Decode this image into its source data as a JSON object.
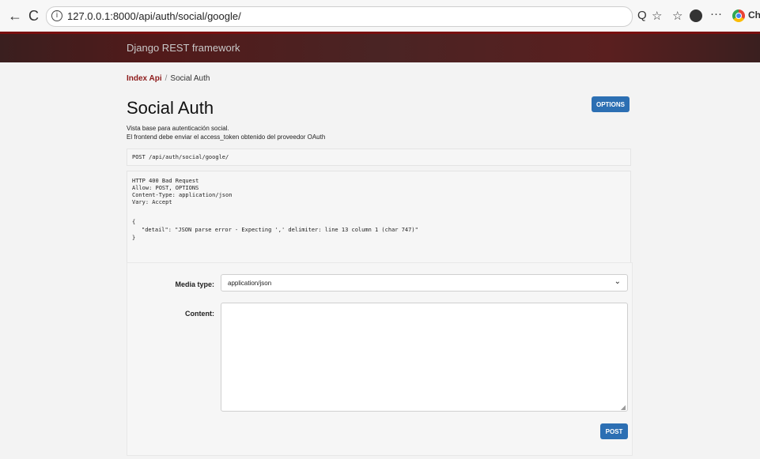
{
  "browser": {
    "back_icon": "←",
    "reload_icon": "C",
    "info_icon": "i",
    "url": "127.0.0.1:8000/api/auth/social/google/",
    "zoom_icon": "Q",
    "favorite_icon": "☆",
    "collections_icon": "☆",
    "more_icon": "···",
    "profile_label": "Ch"
  },
  "navbar": {
    "brand": "Django REST framework"
  },
  "breadcrumb": {
    "root": "Index Api",
    "separator": "/",
    "current": "Social Auth"
  },
  "page": {
    "title": "Social Auth",
    "options_label": "OPTIONS",
    "description_1": "Vista base para autenticación social.",
    "description_2": "El frontend debe enviar el access_token obtenido del proveedor OAuth"
  },
  "request": {
    "line": "POST /api/auth/social/google/"
  },
  "response": {
    "status": "HTTP 400 Bad Request",
    "allow": "Allow: POST, OPTIONS",
    "content_type": "Content-Type: application/json",
    "vary": "Vary: Accept",
    "body_open": "{",
    "detail": "\"detail\": \"JSON parse error - Expecting ',' delimiter: line 13 column 1 (char 747)\"",
    "body_close": "}"
  },
  "form": {
    "media_type_label": "Media type:",
    "media_type_value": "application/json",
    "content_label": "Content:",
    "post_label": "POST"
  }
}
